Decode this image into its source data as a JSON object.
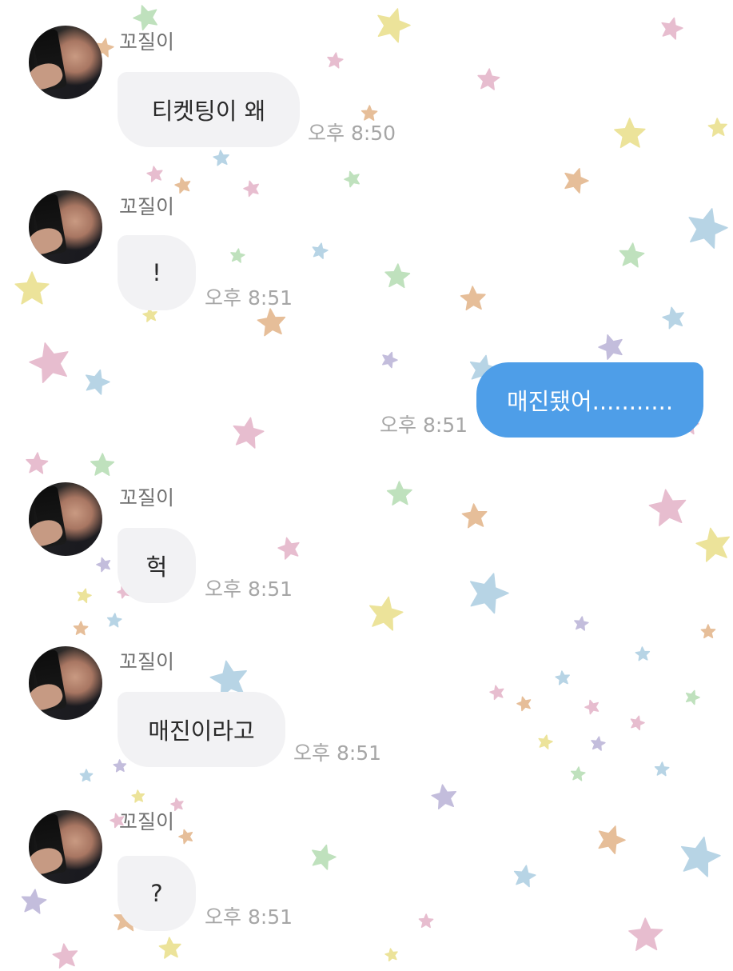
{
  "chat": {
    "sender_name": "꼬질이",
    "messages": [
      {
        "side": "left",
        "text": "티켓팅이 왜",
        "time": "오후 8:50"
      },
      {
        "side": "left",
        "text": "!",
        "time": "오후 8:51"
      },
      {
        "side": "right",
        "text": "매진됐어...........",
        "time": "오후 8:51"
      },
      {
        "side": "left",
        "text": "헉",
        "time": "오후 8:51"
      },
      {
        "side": "left",
        "text": "매진이라고",
        "time": "오후 8:51"
      },
      {
        "side": "left",
        "text": "?",
        "time": "오후 8:51"
      }
    ]
  },
  "theme": {
    "background": "#ffffff",
    "incoming_bubble": "#f2f2f4",
    "outgoing_bubble": "#4e9ee8",
    "time_color": "#a6a6a6",
    "name_color": "#707070",
    "star_colors": [
      "#fff59c",
      "#f9c6dc",
      "#bfe2f7",
      "#c9f1c6",
      "#f8c89a",
      "#cdc6ec"
    ]
  }
}
